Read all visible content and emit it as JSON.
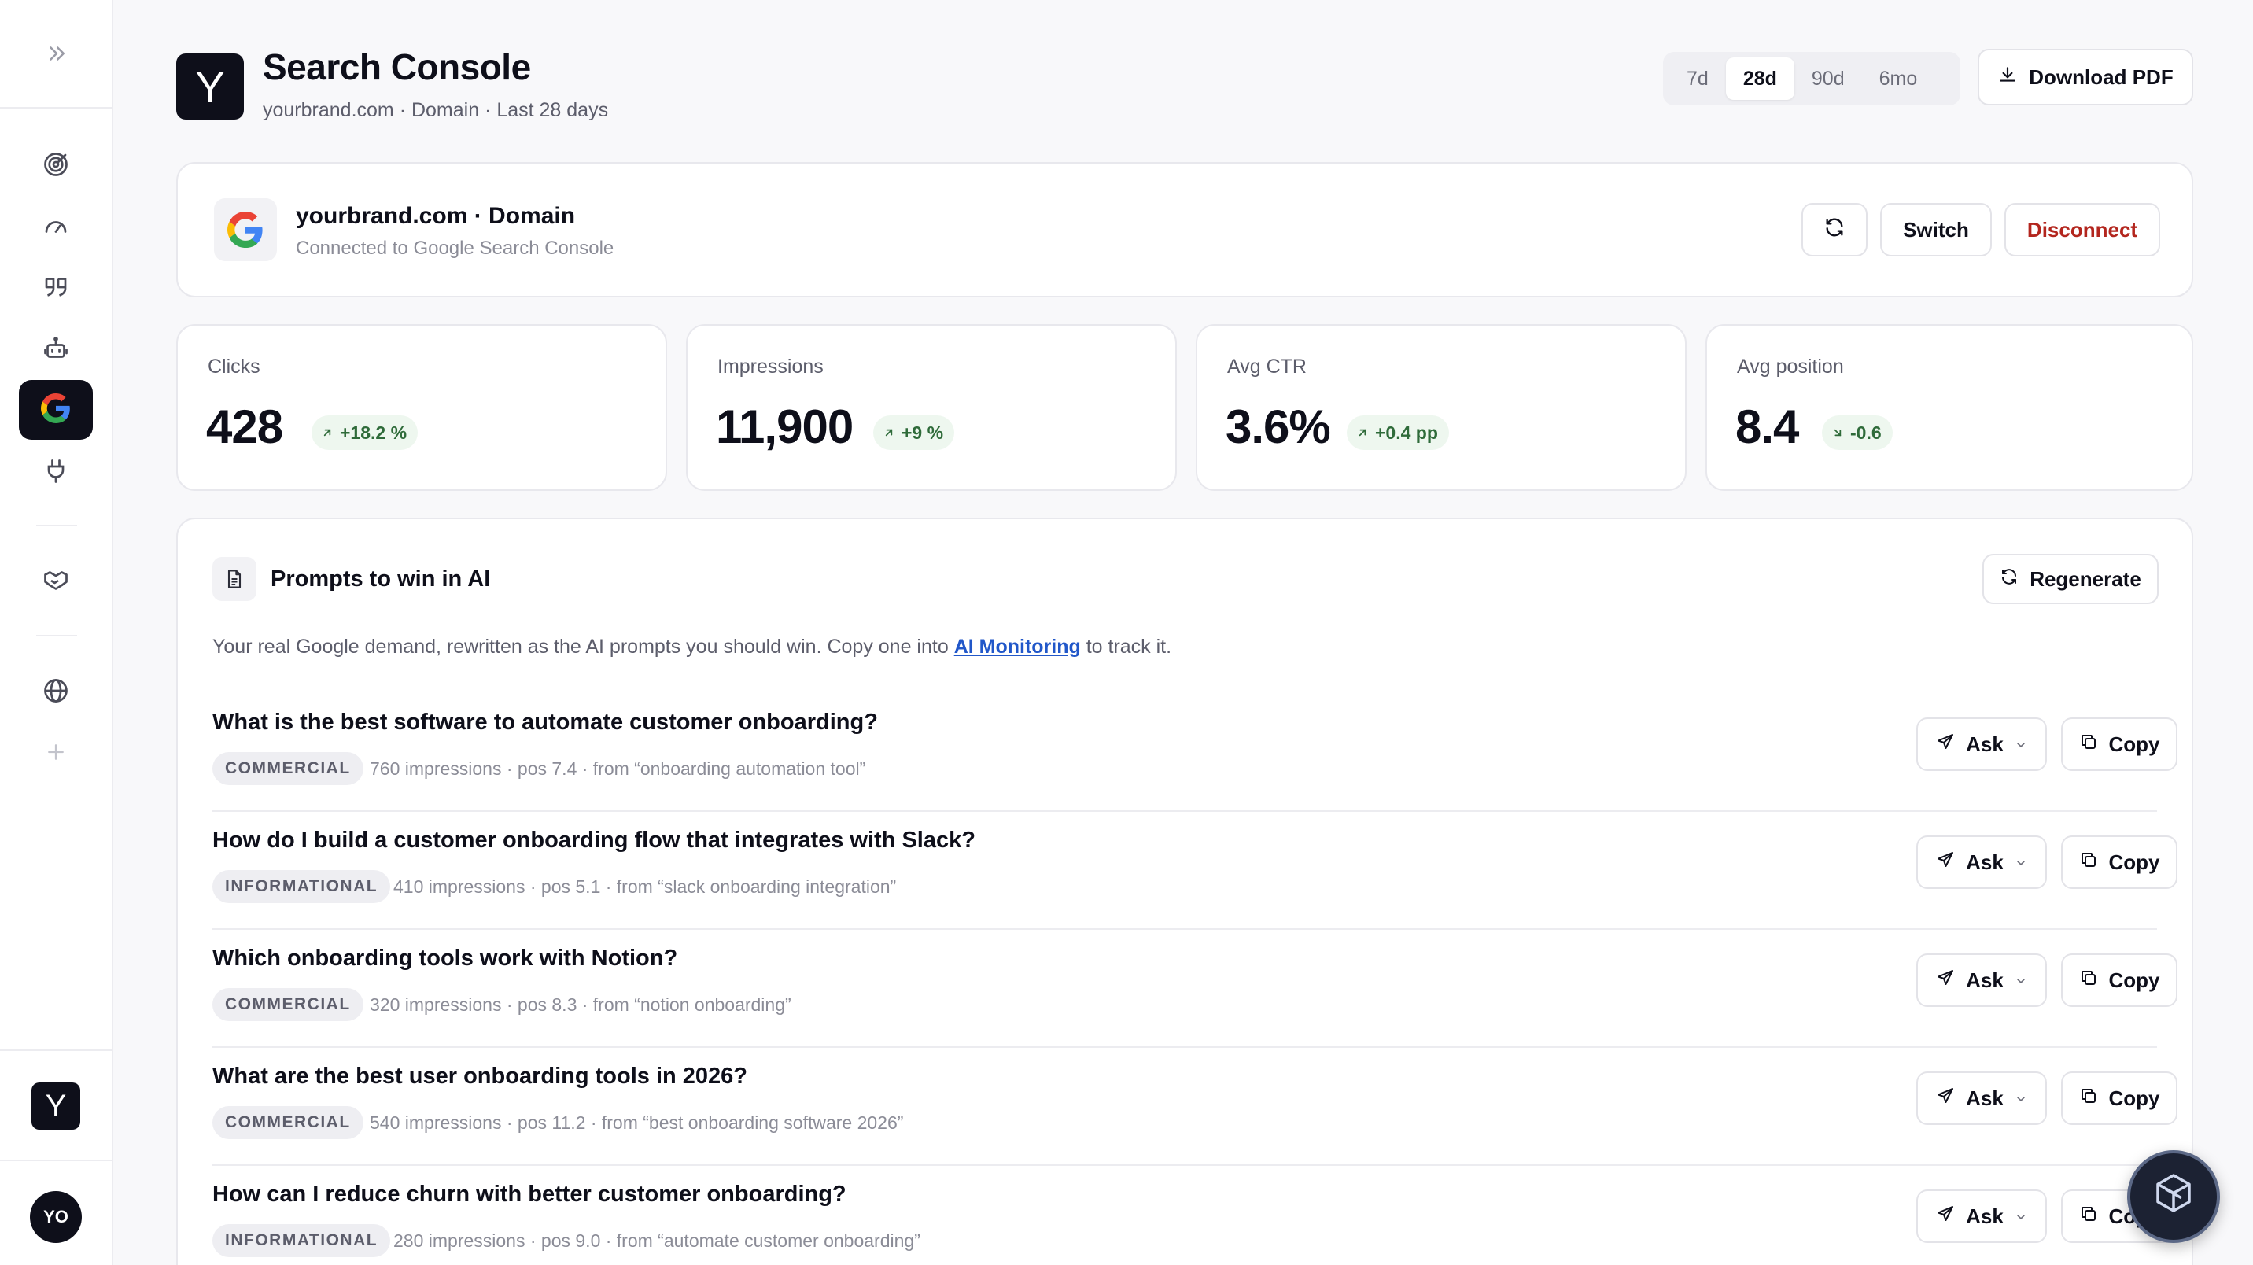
{
  "sidebar": {
    "logo_letter": "Y",
    "avatar_initials": "YO",
    "icons": [
      "expand-icon",
      "target-icon",
      "gauge-icon",
      "quote-icon",
      "robot-icon",
      "google-icon",
      "plug-icon",
      "handshake-icon",
      "globe-icon",
      "plus-icon"
    ]
  },
  "header": {
    "app_letter": "Y",
    "title": "Search Console",
    "subtitle": "yourbrand.com · Domain · Last 28 days",
    "ranges": [
      "7d",
      "28d",
      "90d",
      "6mo"
    ],
    "active_range": "28d",
    "download_label": "Download PDF"
  },
  "connection": {
    "title": "yourbrand.com · Domain",
    "subtitle": "Connected to Google Search Console",
    "switch_label": "Switch",
    "disconnect_label": "Disconnect"
  },
  "metrics": [
    {
      "label": "Clicks",
      "value": "428",
      "delta": "+18.2 %",
      "direction": "up"
    },
    {
      "label": "Impressions",
      "value": "11,900",
      "delta": "+9 %",
      "direction": "up"
    },
    {
      "label": "Avg CTR",
      "value": "3.6%",
      "delta": "+0.4 pp",
      "direction": "up"
    },
    {
      "label": "Avg position",
      "value": "8.4",
      "delta": "-0.6",
      "direction": "down"
    }
  ],
  "prompts": {
    "title": "Prompts to win in AI",
    "regenerate_label": "Regenerate",
    "desc_before": "Your real Google demand, rewritten as the AI prompts you should win. Copy one into ",
    "desc_link": "AI Monitoring",
    "desc_after": " to track it.",
    "ask_label": "Ask",
    "copy_label": "Copy",
    "items": [
      {
        "question": "What is the best software to automate customer onboarding?",
        "tag": "COMMERCIAL",
        "meta": "760 impressions · pos 7.4 · from “onboarding automation tool”"
      },
      {
        "question": "How do I build a customer onboarding flow that integrates with Slack?",
        "tag": "INFORMATIONAL",
        "meta": "410 impressions · pos 5.1 · from “slack onboarding integration”"
      },
      {
        "question": "Which onboarding tools work with Notion?",
        "tag": "COMMERCIAL",
        "meta": "320 impressions · pos 8.3 · from “notion onboarding”"
      },
      {
        "question": "What are the best user onboarding tools in 2026?",
        "tag": "COMMERCIAL",
        "meta": "540 impressions · pos 11.2 · from “best onboarding software 2026”"
      },
      {
        "question": "How can I reduce churn with better customer onboarding?",
        "tag": "INFORMATIONAL",
        "meta": "280 impressions · pos 9.0 · from “automate customer onboarding”"
      }
    ]
  },
  "colors": {
    "accent_dark": "#0e0f1a",
    "positive_bg": "#eef7ef",
    "positive_text": "#2f6b3a",
    "disconnect_text": "#b3261e",
    "link": "#2157c9"
  }
}
